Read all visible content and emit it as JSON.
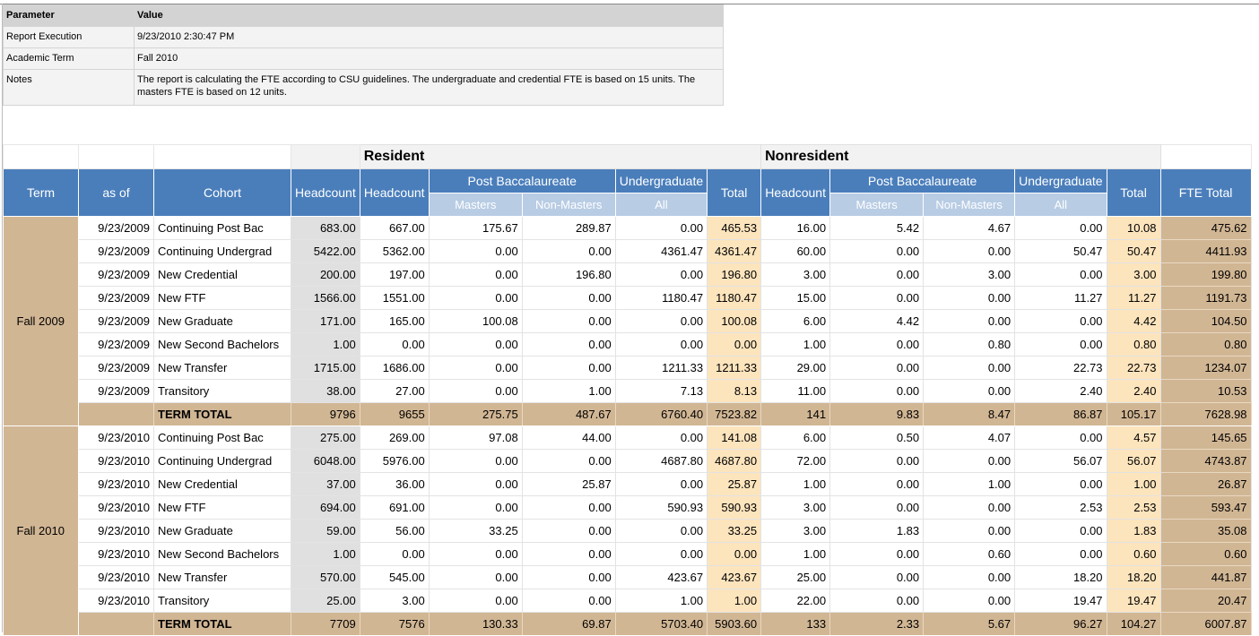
{
  "params": {
    "header": {
      "param": "Parameter",
      "value": "Value"
    },
    "rows": [
      {
        "param": "Report Execution",
        "value": "9/23/2010 2:30:47 PM"
      },
      {
        "param": "Academic Term",
        "value": "Fall 2010"
      },
      {
        "param": "Notes",
        "value": "The report is calculating the FTE according to CSU guidelines. The undergraduate and credential FTE is based on 15 units.  The masters FTE is based on 12 units."
      }
    ]
  },
  "report": {
    "groups": {
      "resident": "Resident",
      "nonresident": "Nonresident"
    },
    "headers": {
      "term": "Term",
      "as_of": "as of",
      "cohort": "Cohort",
      "headcount": "Headcount",
      "post_bacc": "Post Baccalaureate",
      "undergraduate": "Undergraduate",
      "total": "Total",
      "fte_total": "FTE Total",
      "masters": "Masters",
      "non_masters": "Non-Masters",
      "all": "All"
    },
    "terms": [
      {
        "term": "Fall 2009",
        "rows": [
          [
            "9/23/2009",
            "Continuing Post Bac",
            "683.00",
            "667.00",
            "175.67",
            "289.87",
            "0.00",
            "465.53",
            "16.00",
            "5.42",
            "4.67",
            "0.00",
            "10.08",
            "475.62"
          ],
          [
            "9/23/2009",
            "Continuing Undergrad",
            "5422.00",
            "5362.00",
            "0.00",
            "0.00",
            "4361.47",
            "4361.47",
            "60.00",
            "0.00",
            "0.00",
            "50.47",
            "50.47",
            "4411.93"
          ],
          [
            "9/23/2009",
            "New Credential",
            "200.00",
            "197.00",
            "0.00",
            "196.80",
            "0.00",
            "196.80",
            "3.00",
            "0.00",
            "3.00",
            "0.00",
            "3.00",
            "199.80"
          ],
          [
            "9/23/2009",
            "New FTF",
            "1566.00",
            "1551.00",
            "0.00",
            "0.00",
            "1180.47",
            "1180.47",
            "15.00",
            "0.00",
            "0.00",
            "11.27",
            "11.27",
            "1191.73"
          ],
          [
            "9/23/2009",
            "New Graduate",
            "171.00",
            "165.00",
            "100.08",
            "0.00",
            "0.00",
            "100.08",
            "6.00",
            "4.42",
            "0.00",
            "0.00",
            "4.42",
            "104.50"
          ],
          [
            "9/23/2009",
            "New Second Bachelors",
            "1.00",
            "0.00",
            "0.00",
            "0.00",
            "0.00",
            "0.00",
            "1.00",
            "0.00",
            "0.80",
            "0.00",
            "0.80",
            "0.80"
          ],
          [
            "9/23/2009",
            "New Transfer",
            "1715.00",
            "1686.00",
            "0.00",
            "0.00",
            "1211.33",
            "1211.33",
            "29.00",
            "0.00",
            "0.00",
            "22.73",
            "22.73",
            "1234.07"
          ],
          [
            "9/23/2009",
            "Transitory",
            "38.00",
            "27.00",
            "0.00",
            "1.00",
            "7.13",
            "8.13",
            "11.00",
            "0.00",
            "0.00",
            "2.40",
            "2.40",
            "10.53"
          ]
        ],
        "total": [
          "TERM TOTAL",
          "9796",
          "9655",
          "275.75",
          "487.67",
          "6760.40",
          "7523.82",
          "141",
          "9.83",
          "8.47",
          "86.87",
          "105.17",
          "7628.98"
        ]
      },
      {
        "term": "Fall 2010",
        "rows": [
          [
            "9/23/2010",
            "Continuing Post Bac",
            "275.00",
            "269.00",
            "97.08",
            "44.00",
            "0.00",
            "141.08",
            "6.00",
            "0.50",
            "4.07",
            "0.00",
            "4.57",
            "145.65"
          ],
          [
            "9/23/2010",
            "Continuing Undergrad",
            "6048.00",
            "5976.00",
            "0.00",
            "0.00",
            "4687.80",
            "4687.80",
            "72.00",
            "0.00",
            "0.00",
            "56.07",
            "56.07",
            "4743.87"
          ],
          [
            "9/23/2010",
            "New Credential",
            "37.00",
            "36.00",
            "0.00",
            "25.87",
            "0.00",
            "25.87",
            "1.00",
            "0.00",
            "1.00",
            "0.00",
            "1.00",
            "26.87"
          ],
          [
            "9/23/2010",
            "New FTF",
            "694.00",
            "691.00",
            "0.00",
            "0.00",
            "590.93",
            "590.93",
            "3.00",
            "0.00",
            "0.00",
            "2.53",
            "2.53",
            "593.47"
          ],
          [
            "9/23/2010",
            "New Graduate",
            "59.00",
            "56.00",
            "33.25",
            "0.00",
            "0.00",
            "33.25",
            "3.00",
            "1.83",
            "0.00",
            "0.00",
            "1.83",
            "35.08"
          ],
          [
            "9/23/2010",
            "New Second Bachelors",
            "1.00",
            "0.00",
            "0.00",
            "0.00",
            "0.00",
            "0.00",
            "1.00",
            "0.00",
            "0.60",
            "0.00",
            "0.60",
            "0.60"
          ],
          [
            "9/23/2010",
            "New Transfer",
            "570.00",
            "545.00",
            "0.00",
            "0.00",
            "423.67",
            "423.67",
            "25.00",
            "0.00",
            "0.00",
            "18.20",
            "18.20",
            "441.87"
          ],
          [
            "9/23/2010",
            "Transitory",
            "25.00",
            "3.00",
            "0.00",
            "0.00",
            "1.00",
            "1.00",
            "22.00",
            "0.00",
            "0.00",
            "19.47",
            "19.47",
            "20.47"
          ]
        ],
        "total": [
          "TERM TOTAL",
          "7709",
          "7576",
          "130.33",
          "69.87",
          "5703.40",
          "5903.60",
          "133",
          "2.33",
          "5.67",
          "96.27",
          "104.27",
          "6007.87"
        ]
      }
    ]
  }
}
